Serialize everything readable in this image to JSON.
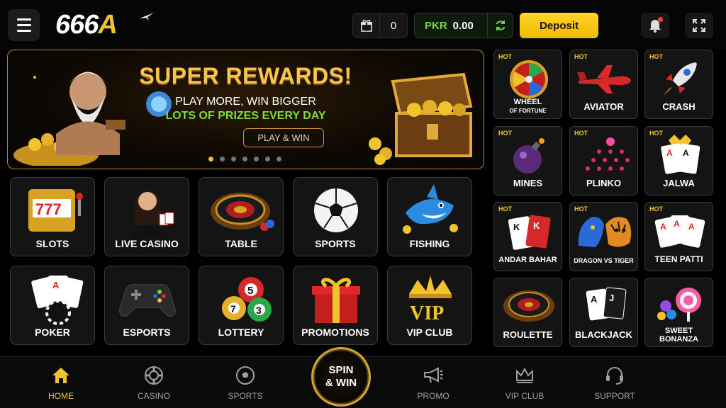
{
  "header": {
    "logo_main": "666",
    "logo_accent": "A",
    "gift_count": "0",
    "currency": "PKR",
    "balance": "0.00",
    "deposit_label": "Deposit"
  },
  "banner": {
    "title": "SUPER REWARDS!",
    "subtitle": "PLAY MORE, WIN BIGGER",
    "subtitle2": "LOTS OF PRIZES EVERY DAY",
    "cta": "PLAY & WIN",
    "slides": 7,
    "active_slide": 1
  },
  "categories": [
    {
      "label": "SLOTS",
      "icon": "slot-machine-icon"
    },
    {
      "label": "LIVE CASINO",
      "icon": "live-dealer-icon"
    },
    {
      "label": "TABLE",
      "icon": "roulette-wheel-icon"
    },
    {
      "label": "SPORTS",
      "icon": "soccer-ball-icon"
    },
    {
      "label": "FISHING",
      "icon": "shark-icon"
    },
    {
      "label": "POKER",
      "icon": "poker-cards-icon"
    },
    {
      "label": "ESPORTS",
      "icon": "gamepad-icon"
    },
    {
      "label": "LOTTERY",
      "icon": "lottery-balls-icon"
    },
    {
      "label": "PROMOTIONS",
      "icon": "gift-box-icon"
    },
    {
      "label": "VIP CLUB",
      "icon": "vip-crown-icon"
    }
  ],
  "games": [
    {
      "hot": "HOT",
      "label": "WHEEL",
      "label2": "OF FORTUNE",
      "icon": "fortune-wheel-icon"
    },
    {
      "hot": "HOT",
      "label": "AVIATOR",
      "icon": "airplane-icon"
    },
    {
      "hot": "HOT",
      "label": "CRASH",
      "icon": "rocket-icon"
    },
    {
      "hot": "HOT",
      "label": "MINES",
      "icon": "bomb-icon"
    },
    {
      "hot": "HOT",
      "label": "PLINKO",
      "icon": "plinko-pegs-icon"
    },
    {
      "hot": "HOT",
      "label": "JALWA",
      "icon": "card-ace-icon"
    },
    {
      "hot": "HOT",
      "label": "ANDAR BAHAR",
      "icon": "king-cards-icon"
    },
    {
      "hot": "HOT",
      "label": "DRAGON VS TIGER",
      "icon": "dragon-tiger-icon"
    },
    {
      "hot": "HOT",
      "label": "TEEN PATTI",
      "icon": "three-aces-icon"
    },
    {
      "hot": "",
      "label": "ROULETTE",
      "icon": "roulette-icon"
    },
    {
      "hot": "",
      "label": "BLACKJACK",
      "icon": "blackjack-cards-icon"
    },
    {
      "hot": "",
      "label": "SWEET",
      "label2": "BONANZA",
      "icon": "candy-icon"
    }
  ],
  "nav": {
    "home": "HOME",
    "casino": "CASINO",
    "sports": "SPORTS",
    "spin_line1": "SPIN",
    "spin_line2": "& WIN",
    "promo": "PROMO",
    "vip": "VIP CLUB",
    "support": "SUPPORT"
  },
  "colors": {
    "accent": "#f2c42c",
    "green": "#6ddb3c",
    "hot": "#f2c42c"
  }
}
